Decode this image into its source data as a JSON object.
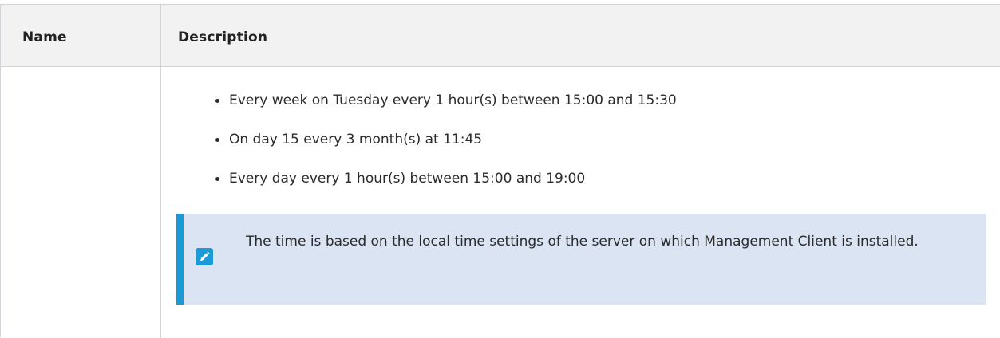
{
  "table": {
    "headers": {
      "name": "Name",
      "description": "Description"
    },
    "bullets": [
      "Every week on Tuesday every 1 hour(s) between 15:00 and 15:30",
      "On day 15 every 3 month(s) at 11:45",
      "Every day every 1 hour(s) between 15:00 and 19:00"
    ],
    "note": {
      "icon": "pencil-icon",
      "text": "The time is based on the local time settings of the server on which Management Client is installed."
    }
  },
  "colors": {
    "note_background": "#dbe4f3",
    "note_accent": "#1a9ad6",
    "header_background": "#f2f2f2",
    "border": "#d0d4d8"
  }
}
